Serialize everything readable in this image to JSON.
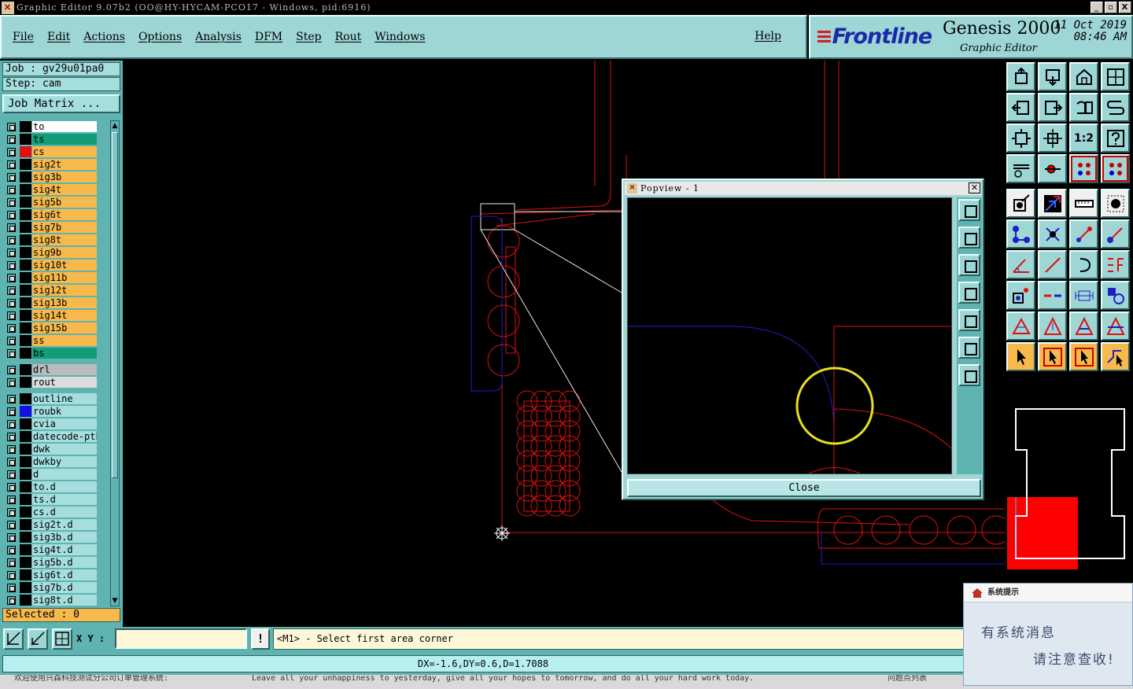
{
  "window": {
    "title": "Graphic Editor 9.07b2 (OO@HY-HYCAM-PCO17 - Windows, pid:6916)",
    "buttons": [
      "_",
      "▫",
      "X"
    ]
  },
  "menu": {
    "items": [
      "File",
      "Edit",
      "Actions",
      "Options",
      "Analysis",
      "DFM",
      "Step",
      "Rout",
      "Windows"
    ],
    "help": "Help"
  },
  "logo": {
    "brand": "Frontline",
    "product": "Genesis 2000",
    "subtitle": "Graphic Editor",
    "date": "11 Oct 2019",
    "time": "08:46 AM"
  },
  "job": {
    "job_line": "Job : gv29u01pa0",
    "step_line": "Step: cam",
    "matrix_button": "Job Matrix ..."
  },
  "layers": [
    {
      "name": "to",
      "bg": "#ffffff",
      "swatch": "#000000",
      "group": 0
    },
    {
      "name": "ts",
      "bg": "#139c78",
      "swatch": "#000000",
      "group": 0
    },
    {
      "name": "cs",
      "bg": "#f7b94c",
      "swatch": "#e01010",
      "group": 0
    },
    {
      "name": "sig2t",
      "bg": "#f7b94c",
      "swatch": "#000000",
      "group": 0
    },
    {
      "name": "sig3b",
      "bg": "#f7b94c",
      "swatch": "#000000",
      "group": 0
    },
    {
      "name": "sig4t",
      "bg": "#f7b94c",
      "swatch": "#000000",
      "group": 0
    },
    {
      "name": "sig5b",
      "bg": "#f7b94c",
      "swatch": "#000000",
      "group": 0
    },
    {
      "name": "sig6t",
      "bg": "#f7b94c",
      "swatch": "#000000",
      "group": 0
    },
    {
      "name": "sig7b",
      "bg": "#f7b94c",
      "swatch": "#000000",
      "group": 0
    },
    {
      "name": "sig8t",
      "bg": "#f7b94c",
      "swatch": "#000000",
      "group": 0
    },
    {
      "name": "sig9b",
      "bg": "#f7b94c",
      "swatch": "#000000",
      "group": 0
    },
    {
      "name": "sig10t",
      "bg": "#f7b94c",
      "swatch": "#000000",
      "group": 0
    },
    {
      "name": "sig11b",
      "bg": "#f7b94c",
      "swatch": "#000000",
      "group": 0
    },
    {
      "name": "sig12t",
      "bg": "#f7b94c",
      "swatch": "#000000",
      "group": 0
    },
    {
      "name": "sig13b",
      "bg": "#f7b94c",
      "swatch": "#000000",
      "group": 0
    },
    {
      "name": "sig14t",
      "bg": "#f7b94c",
      "swatch": "#000000",
      "group": 0
    },
    {
      "name": "sig15b",
      "bg": "#f7b94c",
      "swatch": "#000000",
      "group": 0
    },
    {
      "name": "ss",
      "bg": "#f7b94c",
      "swatch": "#000000",
      "group": 0
    },
    {
      "name": "bs",
      "bg": "#139c78",
      "swatch": "#000000",
      "group": 0
    },
    {
      "name": "drl",
      "bg": "#b8bcbc",
      "swatch": "#000000",
      "group": 1
    },
    {
      "name": "rout",
      "bg": "#dcdcdc",
      "swatch": "#000000",
      "group": 1
    },
    {
      "name": "outline",
      "bg": "#a6dede",
      "swatch": "#000000",
      "group": 2
    },
    {
      "name": "roubk",
      "bg": "#a6dede",
      "swatch": "#1010e0",
      "group": 2
    },
    {
      "name": "cvia",
      "bg": "#a6dede",
      "swatch": "#000000",
      "group": 2
    },
    {
      "name": "datecode-pth",
      "bg": "#a6dede",
      "swatch": "#000000",
      "group": 2
    },
    {
      "name": "dwk",
      "bg": "#a6dede",
      "swatch": "#000000",
      "group": 2
    },
    {
      "name": "dwkby",
      "bg": "#a6dede",
      "swatch": "#000000",
      "group": 2
    },
    {
      "name": "d",
      "bg": "#a6dede",
      "swatch": "#000000",
      "group": 2
    },
    {
      "name": "to.d",
      "bg": "#a6dede",
      "swatch": "#000000",
      "group": 2
    },
    {
      "name": "ts.d",
      "bg": "#a6dede",
      "swatch": "#000000",
      "group": 2
    },
    {
      "name": "cs.d",
      "bg": "#a6dede",
      "swatch": "#000000",
      "group": 2
    },
    {
      "name": "sig2t.d",
      "bg": "#a6dede",
      "swatch": "#000000",
      "group": 2
    },
    {
      "name": "sig3b.d",
      "bg": "#a6dede",
      "swatch": "#000000",
      "group": 2
    },
    {
      "name": "sig4t.d",
      "bg": "#a6dede",
      "swatch": "#000000",
      "group": 2
    },
    {
      "name": "sig5b.d",
      "bg": "#a6dede",
      "swatch": "#000000",
      "group": 2
    },
    {
      "name": "sig6t.d",
      "bg": "#a6dede",
      "swatch": "#000000",
      "group": 2
    },
    {
      "name": "sig7b.d",
      "bg": "#a6dede",
      "swatch": "#000000",
      "group": 2
    },
    {
      "name": "sig8t.d",
      "bg": "#a6dede",
      "swatch": "#000000",
      "group": 2
    }
  ],
  "selected": "Selected : 0",
  "popview": {
    "title": "Popview - 1",
    "close_label": "Close"
  },
  "toolbar": {
    "xy_label": "X Y :",
    "xy_value": "",
    "bang_label": "!",
    "prompt": "<M1> - Select first area corner",
    "one_to_two": "1:2"
  },
  "status": {
    "dx_line": "DX=-1.6,DY=0.6,D=1.7088"
  },
  "taskbar": {
    "left": "欢迎使用兴森科技测试分公司订单管理系统:",
    "motto": "Leave all your unhappiness to yesterday, give all your hopes to tomorrow, and do all your hard work today.",
    "right": "问题点列表"
  },
  "notification": {
    "header": "系统提示",
    "line1": "有系统消息",
    "line2": "请注意查收!"
  },
  "colors": {
    "panel": "#9ed6d6",
    "panel_dark": "#5fb3b0",
    "trace_red": "#e01010",
    "outline_blue": "#2020c0",
    "highlight_yellow": "#e8e020"
  }
}
